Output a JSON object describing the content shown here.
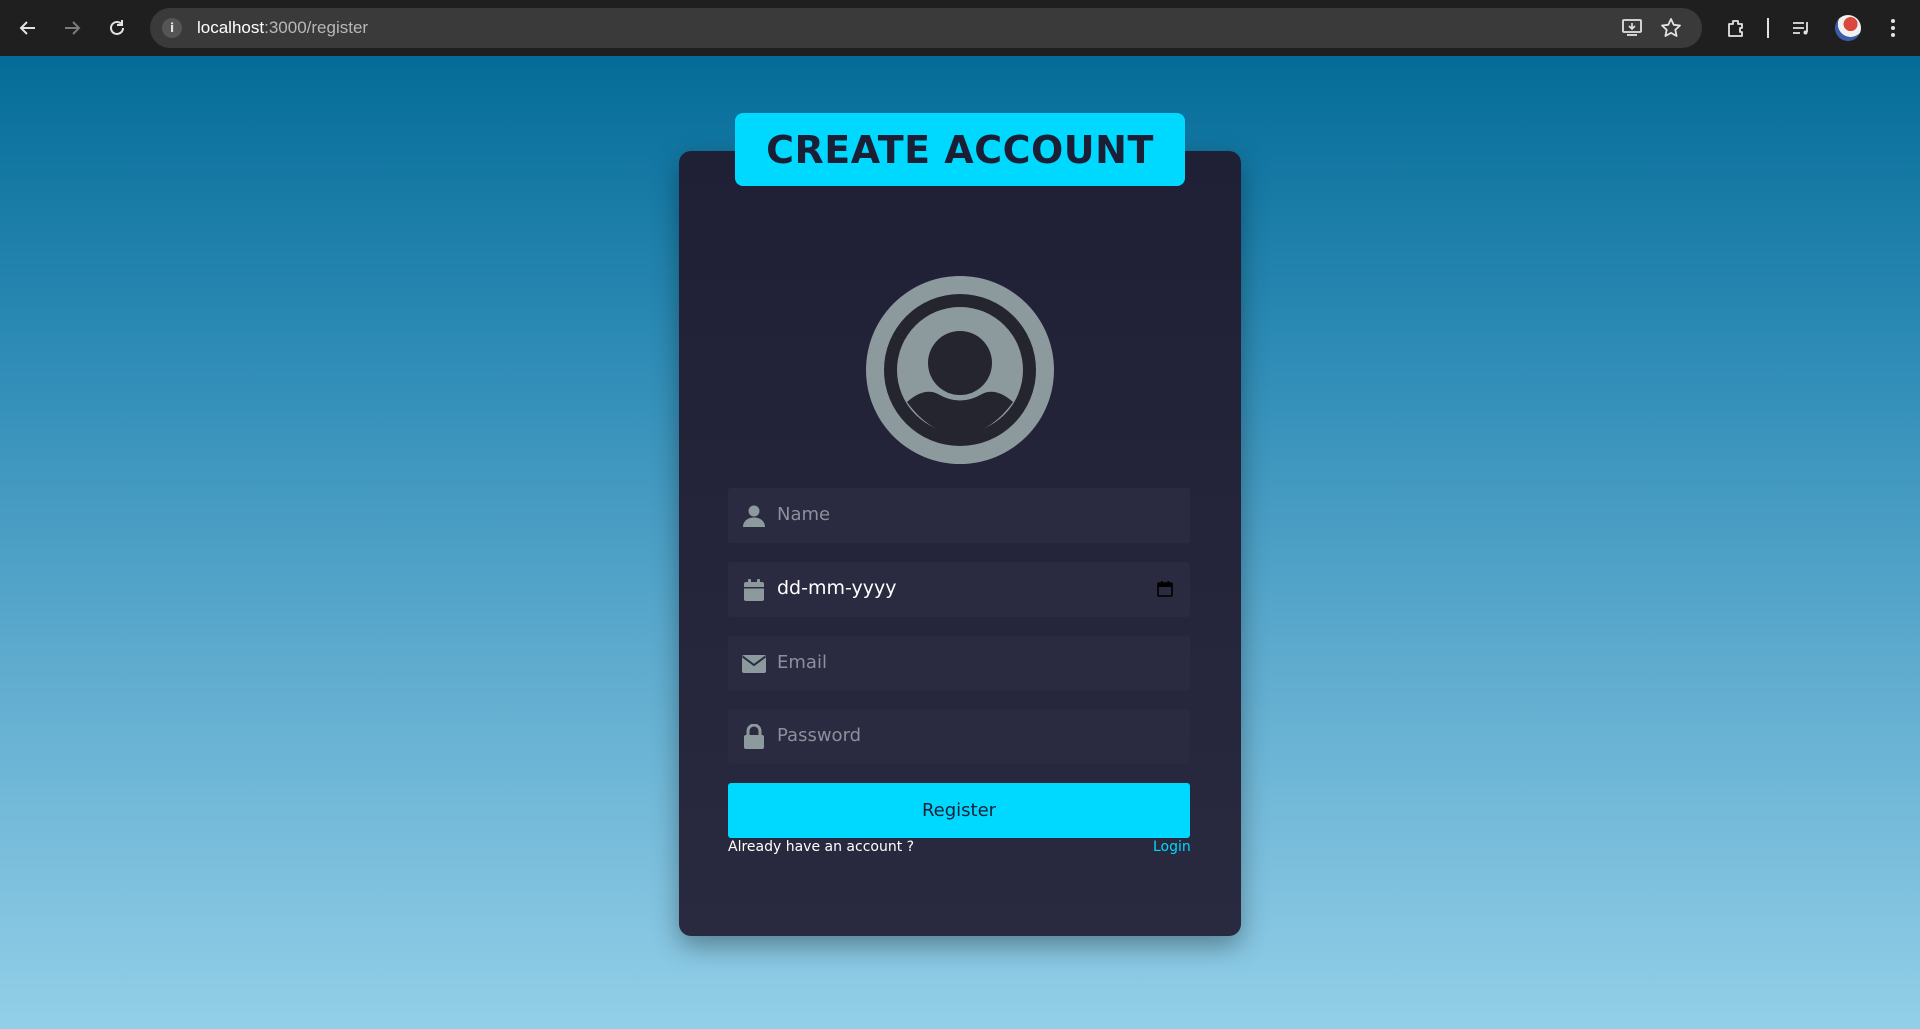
{
  "browser": {
    "url_host": "localhost",
    "url_path": ":3000/register"
  },
  "page": {
    "title": "CREATE ACCOUNT",
    "fields": {
      "name_placeholder": "Name",
      "dob_value": "dd-mm-yyyy",
      "email_placeholder": "Email",
      "password_placeholder": "Password"
    },
    "register_label": "Register",
    "already_text": "Already have an account ?",
    "login_label": "Login"
  },
  "colors": {
    "accent": "#00d9ff",
    "card": "#22223a",
    "field": "#2a2a40",
    "icon": "#8d9a9d"
  }
}
